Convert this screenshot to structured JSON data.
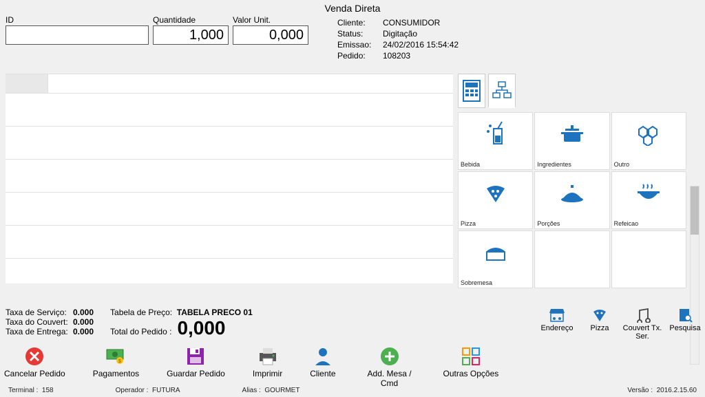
{
  "title": "Venda Direta",
  "inputs": {
    "id_label": "ID",
    "id_value": "",
    "qty_label": "Quantidade",
    "qty_value": "1,000",
    "val_label": "Valor Unit.",
    "val_value": "0,000"
  },
  "info": {
    "cliente_lbl": "Cliente:",
    "cliente_val": "CONSUMIDOR",
    "status_lbl": "Status:",
    "status_val": "Digitação",
    "emissao_lbl": "Emissao:",
    "emissao_val": "24/02/2016 15:54:42",
    "pedido_lbl": "Pedido:",
    "pedido_val": "108203"
  },
  "categories": [
    {
      "label": "Bebida"
    },
    {
      "label": "Ingredientes"
    },
    {
      "label": "Outro"
    },
    {
      "label": "Pizza"
    },
    {
      "label": "Porções"
    },
    {
      "label": "Refeicao"
    },
    {
      "label": "Sobremesa"
    },
    {
      "label": ""
    },
    {
      "label": ""
    }
  ],
  "totals": {
    "taxa_servico_lbl": "Taxa de Serviço:",
    "taxa_servico_val": "0.000",
    "taxa_couvert_lbl": "Taxa do Couvert:",
    "taxa_couvert_val": "0.000",
    "taxa_entrega_lbl": "Taxa de Entrega:",
    "taxa_entrega_val": "0.000",
    "tabela_lbl": "Tabela de Preço:",
    "tabela_val": "TABELA PRECO 01",
    "total_lbl": "Total do Pedido :",
    "total_val": "0,000"
  },
  "right_actions": {
    "endereco": "Endereço",
    "pizza": "Pizza",
    "couvert": "Couvert Tx. Ser.",
    "pesquisa": "Pesquisa"
  },
  "bottom_actions": {
    "cancelar": "Cancelar Pedido",
    "pagamentos": "Pagamentos",
    "guardar": "Guardar Pedido",
    "imprimir": "Imprimir",
    "cliente": "Cliente",
    "addmesa": "Add. Mesa / Cmd",
    "outras": "Outras Opções"
  },
  "status": {
    "terminal_lbl": "Terminal :",
    "terminal_val": "158",
    "operador_lbl": "Operador :",
    "operador_val": "FUTURA",
    "alias_lbl": "Alias :",
    "alias_val": "GOURMET",
    "versao_lbl": "Versão :",
    "versao_val": "2016.2.15.60"
  }
}
